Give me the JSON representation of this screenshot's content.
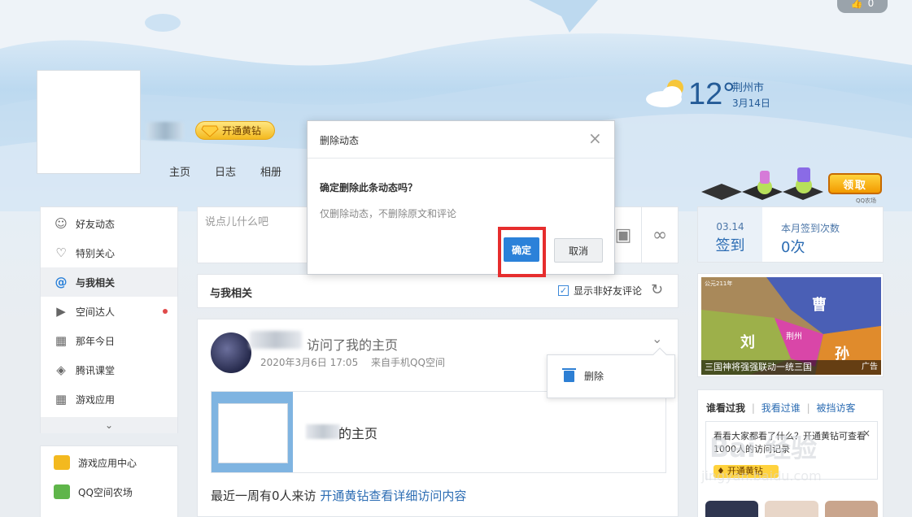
{
  "top_badge": {
    "count": "0"
  },
  "profile": {
    "vip_button": "开通黄钻",
    "nav": [
      "主页",
      "日志",
      "相册"
    ]
  },
  "weather": {
    "temperature": "12°",
    "city": "荆州市",
    "date": "3月14日"
  },
  "game": {
    "claim_button": "领取",
    "brand": "QQ农场"
  },
  "sidebar": {
    "items": [
      {
        "label": "好友动态",
        "icon": "friends-icon"
      },
      {
        "label": "特别关心",
        "icon": "heart-icon"
      },
      {
        "label": "与我相关",
        "icon": "at-icon",
        "active": true
      },
      {
        "label": "空间达人",
        "icon": "play-icon",
        "dot": true
      },
      {
        "label": "那年今日",
        "icon": "calendar-icon"
      },
      {
        "label": "腾讯课堂",
        "icon": "course-icon"
      },
      {
        "label": "游戏应用",
        "icon": "apps-icon"
      }
    ],
    "more_icon": "chevron-down-icon"
  },
  "sidebar2": {
    "items": [
      {
        "label": "游戏应用中心"
      },
      {
        "label": "QQ空间农场"
      }
    ]
  },
  "composer": {
    "placeholder": "说点儿什么吧"
  },
  "section": {
    "title": "与我相关",
    "show_nonfriend_label": "显示非好友评论",
    "show_nonfriend_checked": true
  },
  "feed": {
    "action": "访问了我的主页",
    "time": "2020年3月6日 17:05",
    "source": "来自手机QQ空间",
    "share_title": "的主页",
    "footer_text": "最近一周有0人来访",
    "footer_link": "开通黄钻查看详细访问内容"
  },
  "dropdown": {
    "delete_label": "删除"
  },
  "checkin": {
    "date": "03.14",
    "checkin_label": "签到",
    "month_label": "本月签到次数",
    "month_count": "0次"
  },
  "ad": {
    "caption": "三国神将强强联动一统三国",
    "tag": "广告",
    "map_labels": [
      "曹",
      "刘",
      "孙",
      "荆州"
    ],
    "map_header": "公元211年"
  },
  "visitors": {
    "tabs": [
      "谁看过我",
      "我看过谁",
      "被挡访客"
    ],
    "tip_text": "看看大家都看了什么？开通黄钻可查看1000人的访问记录",
    "tip_button": "开通黄钻"
  },
  "dialog": {
    "title": "删除动态",
    "question": "确定删除此条动态吗？",
    "note": "仅删除动态，不删除原文和评论",
    "ok": "确定",
    "cancel": "取消"
  },
  "watermark": {
    "line1": "Bai 经验",
    "line2": "jingyan.baidu.com"
  },
  "colors": {
    "accent": "#2b81d9",
    "highlight_frame": "#e62d2d",
    "vip_gold": "#f3b91f"
  }
}
